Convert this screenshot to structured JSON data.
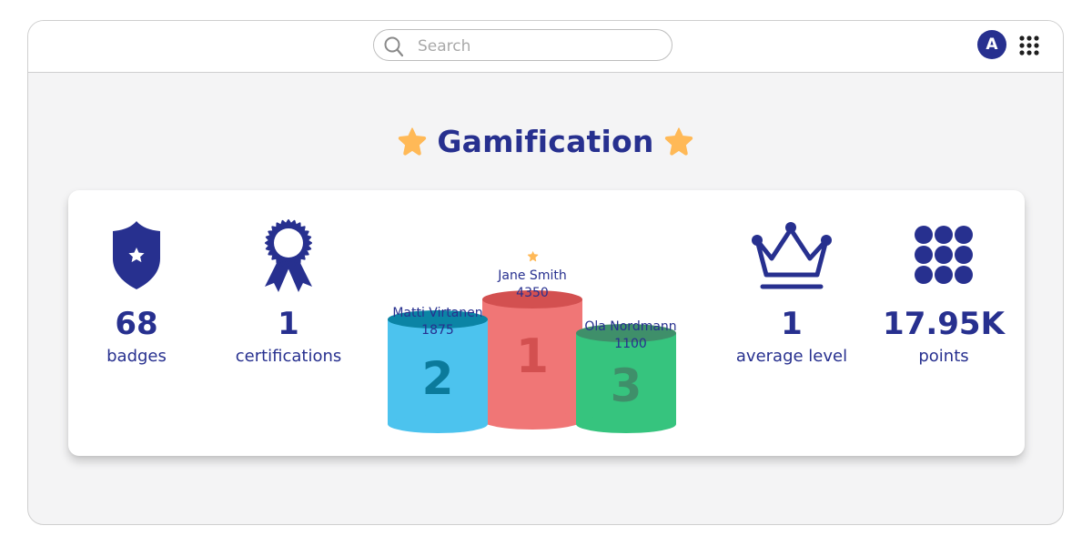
{
  "header": {
    "search": {
      "placeholder": "Search",
      "value": ""
    },
    "avatar_initial": "A",
    "icons": {
      "search": "search-icon",
      "apps": "apps-grid-icon"
    }
  },
  "page": {
    "title": "Gamification",
    "title_icon": "star-icon",
    "accent_color": "#27308f",
    "star_color": "#ffb957"
  },
  "stats": [
    {
      "icon": "shield-star-icon",
      "value": "68",
      "label": "badges"
    },
    {
      "icon": "ribbon-award-icon",
      "value": "1",
      "label": "certifications"
    },
    {
      "icon": "crown-icon",
      "value": "1",
      "label": "average level"
    },
    {
      "icon": "dots-grid-icon",
      "value": "17.95K",
      "label": "points"
    }
  ],
  "leaderboard": {
    "podium": [
      {
        "rank": "1",
        "name": "Jane Smith",
        "points": "4350",
        "color": "#f07676",
        "top_color": "#d35050",
        "digit_color": "#d35050"
      },
      {
        "rank": "2",
        "name": "Matti Virtanen",
        "points": "1875",
        "color": "#4cc3ee",
        "top_color": "#0b84a5",
        "digit_color": "#0b7a9b"
      },
      {
        "rank": "3",
        "name": "Ola Nordmann",
        "points": "1100",
        "color": "#36c47e",
        "top_color": "#3f8f6a",
        "digit_color": "#3f8f6a"
      }
    ]
  }
}
